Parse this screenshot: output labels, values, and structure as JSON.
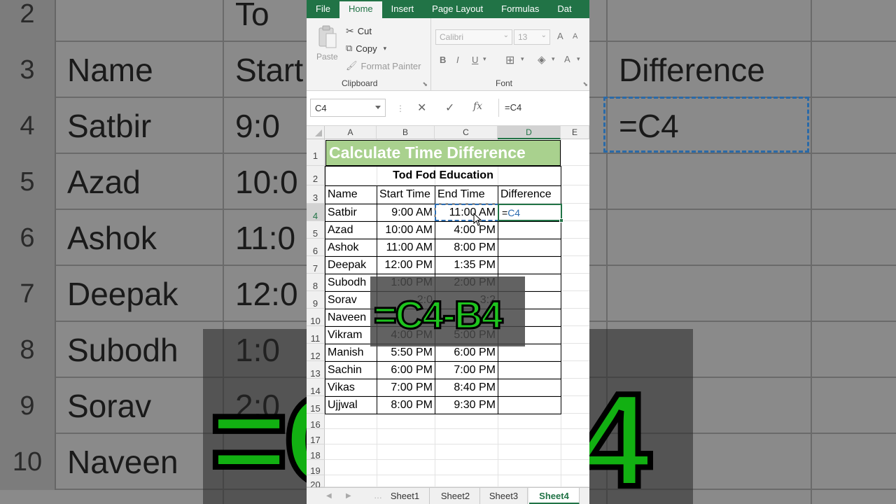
{
  "ribbon": {
    "tabs": [
      "File",
      "Home",
      "Insert",
      "Page Layout",
      "Formulas",
      "Dat"
    ],
    "active_tab": "Home",
    "clipboard": {
      "paste": "Paste",
      "cut": "Cut",
      "copy": "Copy",
      "format_painter": "Format Painter",
      "label": "Clipboard"
    },
    "font": {
      "name": "Calibri",
      "size": "13",
      "bold": "B",
      "italic": "I",
      "underline": "U",
      "grow": "A",
      "shrink": "A",
      "color": "A",
      "label": "Font"
    }
  },
  "formula_bar": {
    "name_box": "C4",
    "cancel": "✕",
    "enter": "✓",
    "fx": "fx",
    "value": "=C4"
  },
  "columns": [
    "A",
    "B",
    "C",
    "D",
    "E"
  ],
  "rows": [
    "1",
    "2",
    "3",
    "4",
    "5",
    "6",
    "7",
    "8",
    "9",
    "10",
    "11",
    "12",
    "13",
    "14",
    "15",
    "16",
    "17",
    "18",
    "19",
    "20"
  ],
  "sheet": {
    "title": "Calculate Time Difference",
    "subtitle": "Tod Fod Education",
    "headers": [
      "Name",
      "Start Time",
      "End Time",
      "Difference"
    ],
    "data": [
      [
        "Satbir",
        "9:00 AM",
        "11:00 AM"
      ],
      [
        "Azad",
        "10:00 AM",
        "4:00 PM"
      ],
      [
        "Ashok",
        "11:00 AM",
        "8:00 PM"
      ],
      [
        "Deepak",
        "12:00 PM",
        "1:35 PM"
      ],
      [
        "Subodh",
        "1:00 PM",
        "2:00 PM"
      ],
      [
        "Sorav",
        "2:0",
        "3:2"
      ],
      [
        "Naveen",
        "",
        ""
      ],
      [
        "Vikram",
        "4:00 PM",
        "5:00 PM"
      ],
      [
        "Manish",
        "5:50 PM",
        "6:00 PM"
      ],
      [
        "Sachin",
        "6:00 PM",
        "7:00 PM"
      ],
      [
        "Vikas",
        "7:00 PM",
        "8:40 PM"
      ],
      [
        "Ujjwal",
        "8:00 PM",
        "9:30 PM"
      ]
    ],
    "editing_formula_prefix": "=",
    "editing_formula_ref": "C4"
  },
  "overlay_formula": "=C4-B4",
  "sheet_tabs": [
    "Sheet1",
    "Sheet2",
    "Sheet3",
    "Sheet4"
  ],
  "active_sheet": "Sheet4",
  "background": {
    "rows": [
      {
        "num": "2",
        "a": "",
        "b": "To",
        "c": ""
      },
      {
        "num": "3",
        "a": "Name",
        "b": "Start",
        "c": "Difference"
      },
      {
        "num": "4",
        "a": "Satbir",
        "b": "9:0",
        "c": "=C4"
      },
      {
        "num": "5",
        "a": "Azad",
        "b": "10:0",
        "c": ""
      },
      {
        "num": "6",
        "a": "Ashok",
        "b": "11:0",
        "c": ""
      },
      {
        "num": "7",
        "a": "Deepak",
        "b": "12:0",
        "c": ""
      },
      {
        "num": "8",
        "a": "Subodh",
        "b": "1:0",
        "c": ""
      },
      {
        "num": "9",
        "a": "Sorav",
        "b": "2:0",
        "c": ""
      },
      {
        "num": "10",
        "a": "Naveen",
        "b": "",
        "c": ""
      }
    ],
    "overlay_formula": "=C4-B4"
  },
  "colors": {
    "excel_green": "#217346",
    "title_fill": "#a9d18e",
    "marching_ants": "#2b6cb0",
    "overlay_green": "#1ec41e"
  }
}
